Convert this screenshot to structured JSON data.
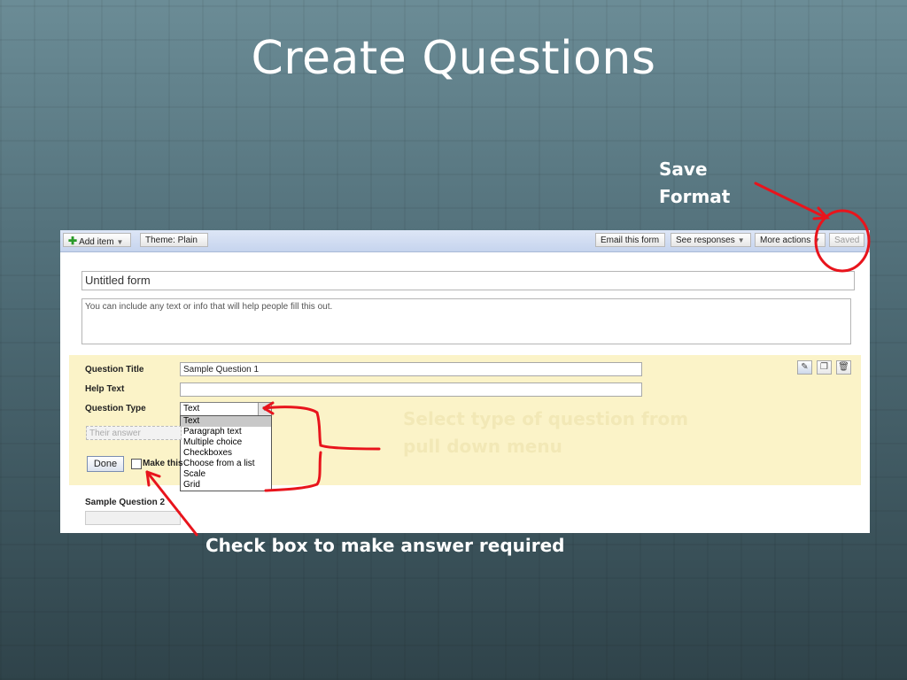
{
  "slide": {
    "title": "Create Questions",
    "notes": {
      "save_line1": "Save",
      "save_line2": "Format",
      "select_line1": "Select type of question from",
      "select_line2": "pull down menu",
      "checkbox": "Check box to make answer required"
    }
  },
  "toolbar": {
    "add_item": "Add item",
    "theme": "Theme:  Plain",
    "email": "Email this form",
    "see_responses": "See responses",
    "more_actions": "More actions",
    "saved": "Saved"
  },
  "form": {
    "title_value": "Untitled form",
    "description_value": "You can include any text or info that will help people fill this out."
  },
  "question": {
    "title_label": "Question Title",
    "title_value": "Sample Question 1",
    "help_label": "Help Text",
    "help_value": "",
    "type_label": "Question Type",
    "type_selected": "Text",
    "type_options": [
      "Text",
      "Paragraph text",
      "Multiple choice",
      "Checkboxes",
      "Choose from a list",
      "Scale",
      "Grid"
    ],
    "answer_placeholder": "Their answer",
    "done_label": "Done",
    "required_label": "Make this"
  },
  "question2": {
    "title": "Sample Question 2"
  },
  "colors": {
    "annotation": "#e8141c",
    "edit_background": "#fbf3c8"
  },
  "icons": {
    "edit": "pencil-icon",
    "duplicate": "duplicate-icon",
    "delete": "trash-icon"
  }
}
